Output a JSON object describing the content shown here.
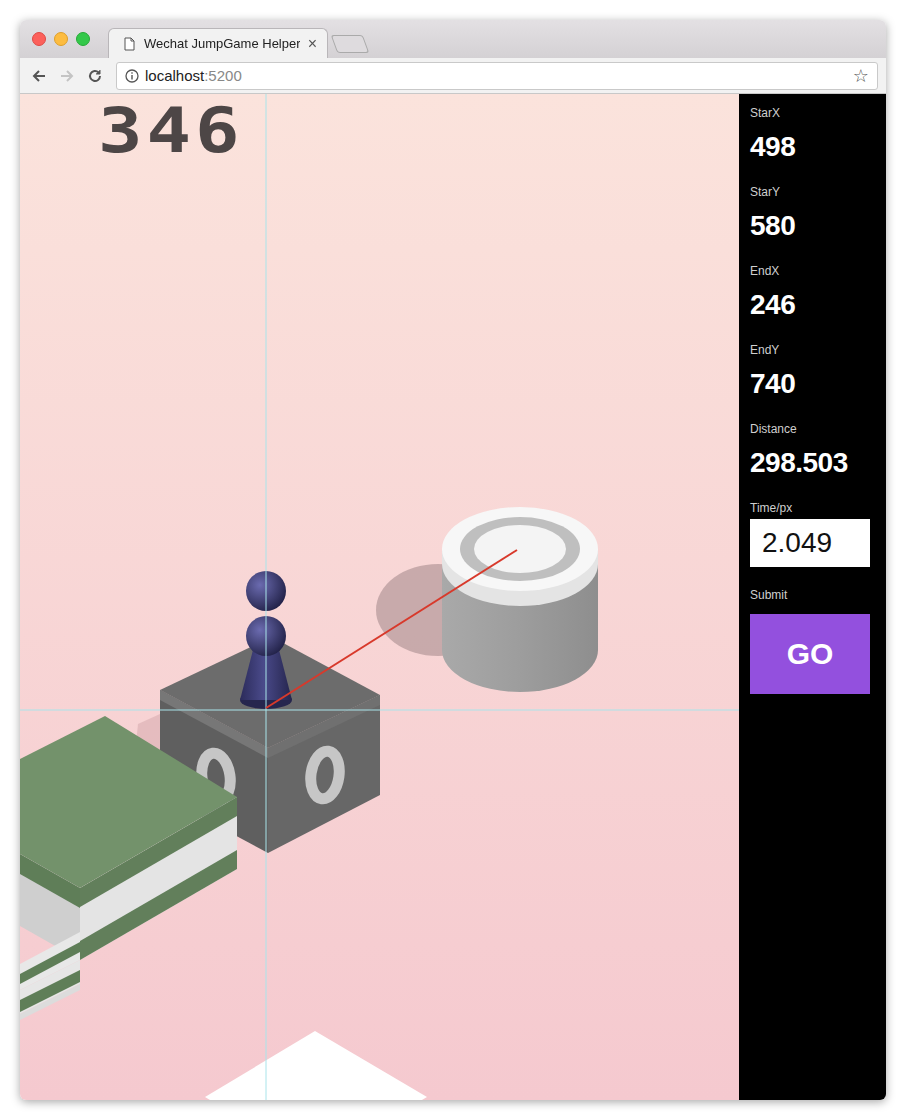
{
  "window": {
    "title": "Wechat JumpGame Helper"
  },
  "tab": {
    "label": "Wechat JumpGame Helper",
    "close": "×",
    "selected": true
  },
  "nav": {
    "back": {
      "disabled": false
    },
    "forward": {
      "disabled": true
    }
  },
  "address_bar": {
    "host": "localhost",
    "port": ":5200",
    "star": "☆"
  },
  "game": {
    "score": "346"
  },
  "sidebar": {
    "fields": [
      {
        "label": "StarX",
        "value": "498"
      },
      {
        "label": "StarY",
        "value": "580"
      },
      {
        "label": "EndX",
        "value": "246"
      },
      {
        "label": "EndY",
        "value": "740"
      },
      {
        "label": "Distance",
        "value": "298.503"
      }
    ],
    "time": {
      "label": "Time/px",
      "value": "2.049"
    },
    "submit": {
      "label": "Submit",
      "button": "GO"
    }
  }
}
